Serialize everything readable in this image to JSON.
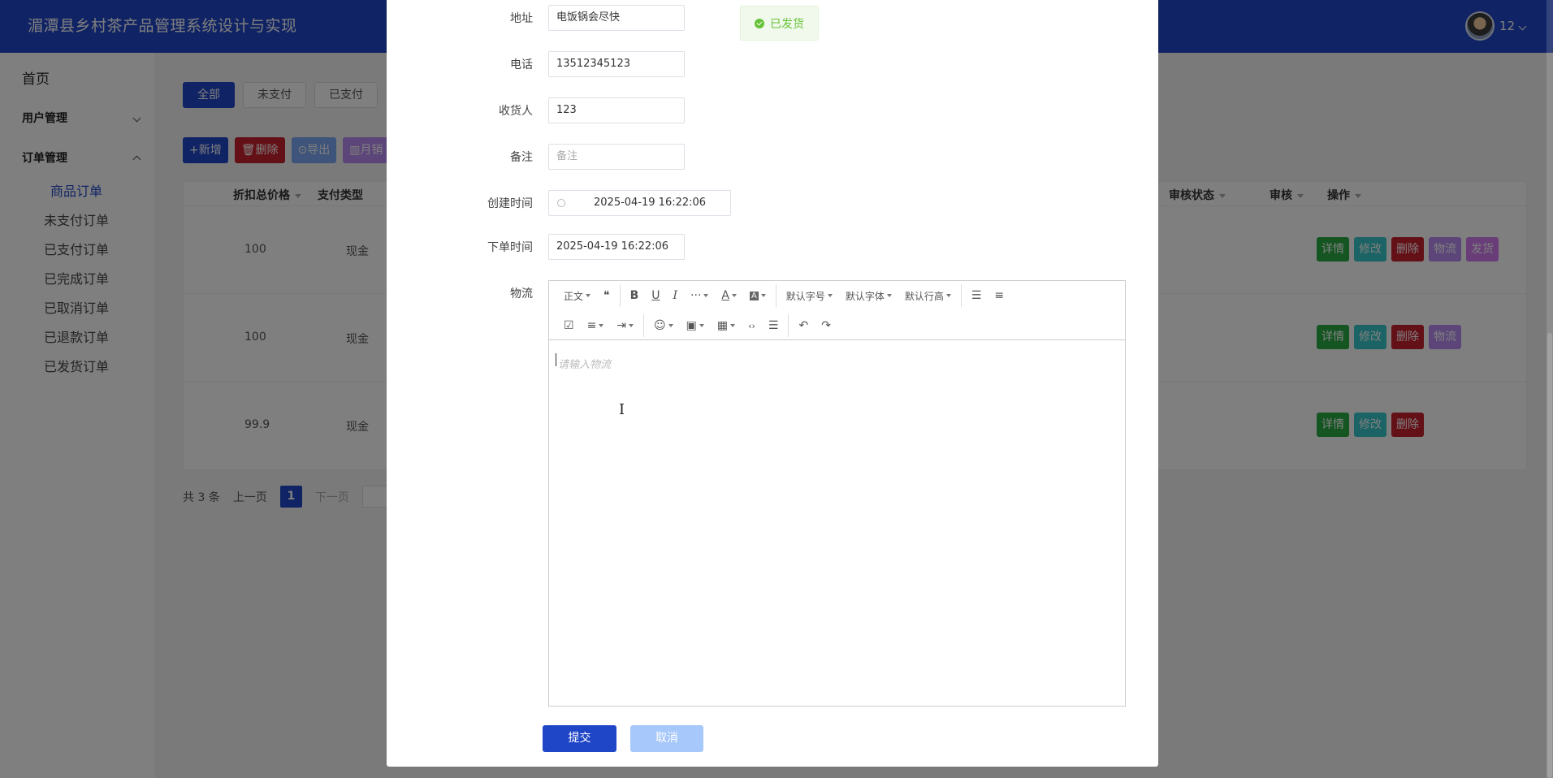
{
  "app": {
    "title": "湄潭县乡村茶产品管理系统设计与实现",
    "user_short": "12"
  },
  "sidebar": {
    "home": "首页",
    "groups": [
      {
        "label": "用户管理",
        "expanded": false
      },
      {
        "label": "订单管理",
        "expanded": true
      }
    ],
    "order_items": [
      "商品订单",
      "未支付订单",
      "已支付订单",
      "已完成订单",
      "已取消订单",
      "已退款订单",
      "已发货订单"
    ]
  },
  "filters": [
    "全部",
    "未支付",
    "已支付"
  ],
  "actions": {
    "add": "+新增",
    "delete": "删除",
    "export": "导出",
    "month": "月销"
  },
  "table": {
    "headers": [
      "折扣总价格",
      "支付类型",
      "审核状态",
      "审核",
      "操作"
    ],
    "rows": [
      {
        "price": "100",
        "pay": "现金",
        "ops": [
          "详情",
          "修改",
          "删除",
          "物流",
          "发货"
        ]
      },
      {
        "price": "100",
        "pay": "现金",
        "ops": [
          "详情",
          "修改",
          "删除",
          "物流"
        ]
      },
      {
        "price": "99.9",
        "pay": "现金",
        "ops": [
          "详情",
          "修改",
          "删除"
        ]
      }
    ]
  },
  "pagination": {
    "total": "共 3 条",
    "prev": "上一页",
    "current": "1",
    "next": "下一页"
  },
  "form": {
    "address_label": "地址",
    "address_value": "电饭锅会尽快",
    "status_tag": "已发货",
    "phone_label": "电话",
    "phone_value": "13512345123",
    "receiver_label": "收货人",
    "receiver_value": "123",
    "remark_label": "备注",
    "remark_placeholder": "备注",
    "created_label": "创建时间",
    "created_value": "2025-04-19 16:22:06",
    "order_label": "下单时间",
    "order_value": "2025-04-19 16:22:06",
    "logistics_label": "物流",
    "logistics_placeholder": "请输入物流",
    "submit": "提交",
    "cancel": "取消"
  },
  "editor_toolbar": {
    "paragraph": "正文",
    "font_size": "默认字号",
    "font_family": "默认字体",
    "line_height": "默认行高"
  },
  "colors": {
    "brand": "#2046c8",
    "success": "#67c23a",
    "danger": "#c9202e"
  }
}
